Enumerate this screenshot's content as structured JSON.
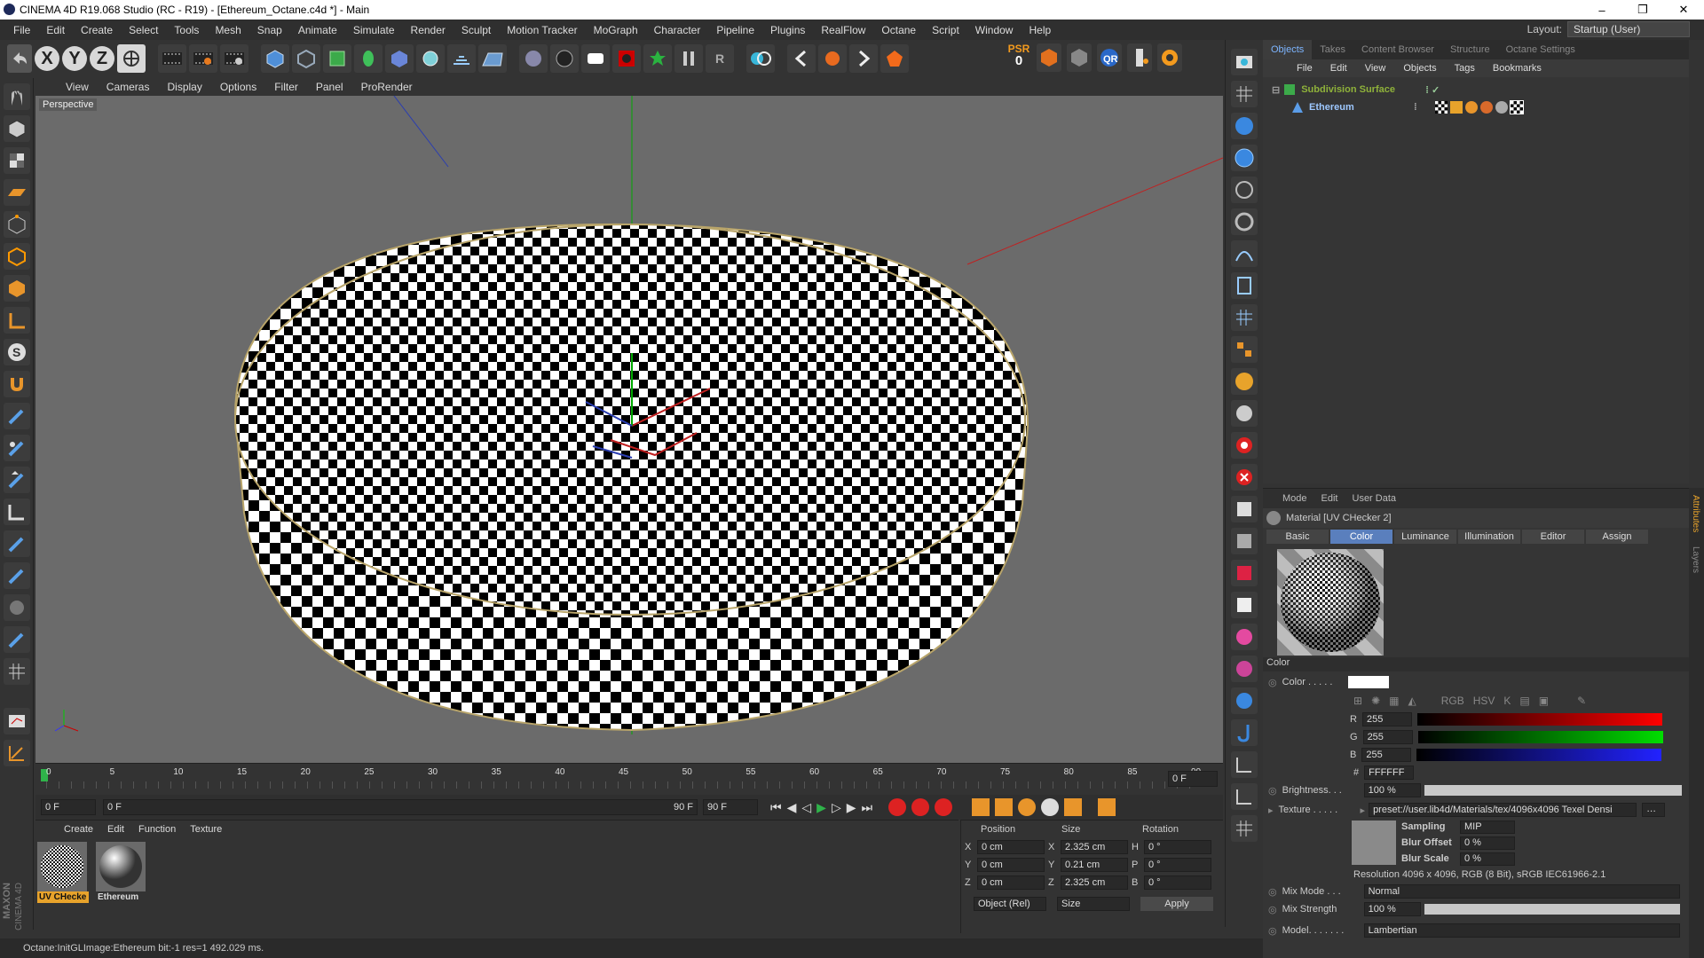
{
  "window": {
    "title": "CINEMA 4D R19.068 Studio (RC - R19) - [Ethereum_Octane.c4d *] - Main",
    "minimize": "–",
    "maximize": "❐",
    "close": "✕"
  },
  "menu": [
    "File",
    "Edit",
    "Create",
    "Select",
    "Tools",
    "Mesh",
    "Snap",
    "Animate",
    "Simulate",
    "Render",
    "Sculpt",
    "Motion Tracker",
    "MoGraph",
    "Character",
    "Pipeline",
    "Plugins",
    "RealFlow",
    "Octane",
    "Script",
    "Window",
    "Help"
  ],
  "layout": {
    "label": "Layout:",
    "value": "Startup (User)"
  },
  "toolbar": {
    "x": "X",
    "y": "Y",
    "z": "Z",
    "psr_label": "PSR",
    "psr_value": "0",
    "r_label": "R"
  },
  "viewport_menu": [
    "View",
    "Cameras",
    "Display",
    "Options",
    "Filter",
    "Panel",
    "ProRender"
  ],
  "viewport": {
    "label": "Perspective"
  },
  "timeline": {
    "ticks": [
      "0",
      "5",
      "10",
      "15",
      "20",
      "25",
      "30",
      "35",
      "40",
      "45",
      "50",
      "55",
      "60",
      "65",
      "70",
      "75",
      "80",
      "85",
      "90"
    ],
    "frame_end": "0 F"
  },
  "transport": {
    "start": "0 F",
    "range_start": "0 F",
    "range_end": "90 F",
    "end": "90 F"
  },
  "material_menu": [
    "Create",
    "Edit",
    "Function",
    "Texture"
  ],
  "materials": [
    {
      "name": "UV CHecke",
      "selected": true
    },
    {
      "name": "Ethereum",
      "selected": false
    }
  ],
  "coords": {
    "headers": [
      "Position",
      "Size",
      "Rotation"
    ],
    "rows": [
      {
        "axis": "X",
        "pos": "0 cm",
        "saxis": "X",
        "size": "2.325 cm",
        "raxis": "H",
        "rot": "0 °"
      },
      {
        "axis": "Y",
        "pos": "0 cm",
        "saxis": "Y",
        "size": "0.21 cm",
        "raxis": "P",
        "rot": "0 °"
      },
      {
        "axis": "Z",
        "pos": "0 cm",
        "saxis": "Z",
        "size": "2.325 cm",
        "raxis": "B",
        "rot": "0 °"
      }
    ],
    "mode": "Object (Rel)",
    "size_mode": "Size",
    "apply": "Apply"
  },
  "objects": {
    "tabs": [
      "Objects",
      "Takes",
      "Content Browser",
      "Structure",
      "Octane Settings"
    ],
    "menu": [
      "File",
      "Edit",
      "View",
      "Objects",
      "Tags",
      "Bookmarks"
    ],
    "items": [
      {
        "name": "Subdivision Surface"
      },
      {
        "name": "Ethereum"
      }
    ]
  },
  "attributes": {
    "menu": [
      "Mode",
      "Edit",
      "User Data"
    ],
    "title": "Material [UV CHecker 2]",
    "tabs": [
      "Basic",
      "Color",
      "Luminance",
      "Illumination",
      "Editor",
      "Assign"
    ],
    "section": "Color",
    "color_label": "Color . . . . .",
    "r_label": "R",
    "r": "255",
    "g_label": "G",
    "g": "255",
    "b_label": "B",
    "b": "255",
    "hex_label": "#",
    "hex": "FFFFFF",
    "brightness_label": "Brightness. . .",
    "brightness": "100 %",
    "texture_label": "Texture . . . . .",
    "texture_path": "preset://user.lib4d/Materials/tex/4096x4096 Texel Densi",
    "sampling_label": "Sampling",
    "sampling": "MIP",
    "blur_offset_label": "Blur Offset",
    "blur_offset": "0 %",
    "blur_scale_label": "Blur Scale",
    "blur_scale": "0 %",
    "resolution": "Resolution 4096 x 4096, RGB (8 Bit), sRGB IEC61966-2.1",
    "mix_mode_label": "Mix Mode . . .",
    "mix_mode": "Normal",
    "mix_strength_label": "Mix Strength",
    "mix_strength": "100 %",
    "model_label": "Model. . . . . . .",
    "model": "Lambertian",
    "side_tabs": [
      "Attributes",
      "Layers"
    ]
  },
  "status": "Octane:InitGLImage:Ethereum  bit:-1 res=1  492.029 ms.",
  "brand": {
    "maxon": "MAXON",
    "c4d": "CINEMA 4D"
  }
}
